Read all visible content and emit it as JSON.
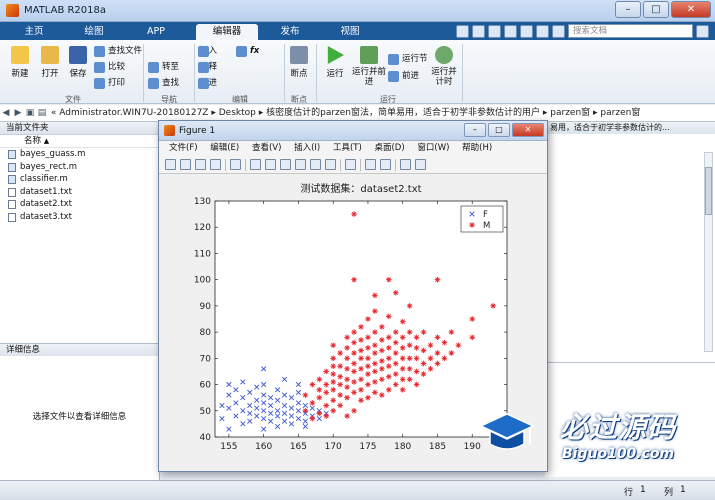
{
  "window": {
    "title": "MATLAB R2018a"
  },
  "tabs": [
    "主页",
    "绘图",
    "APP",
    "编辑器",
    "发布",
    "视图"
  ],
  "search": {
    "placeholder": "搜索文档"
  },
  "ribbon": {
    "file_group": {
      "new": "新建",
      "open": "打开",
      "save": "保存",
      "find_file": "查找文件",
      "compare": "比较",
      "print": "打印",
      "label": "文件"
    },
    "nav_group": {
      "goto": "转至",
      "find": "查找",
      "label": "导航"
    },
    "edit_group": {
      "insert": "插入",
      "comment": "注释",
      "indent": "缩进",
      "fx": "fx",
      "label": "编辑"
    },
    "breakpoint_group": {
      "breakpoints": "断点",
      "label": "断点"
    },
    "run_group": {
      "run": "运行",
      "run_advance": "运行并前进",
      "run_section": "运行节",
      "advance": "前进",
      "run_time": "运行并计时",
      "label": "运行"
    }
  },
  "address": {
    "segments": [
      "«",
      "Administrator.WIN7U-20180127Z",
      "Desktop",
      "核密度估计的parzen窗法，简单易用，适合于初学非参数估计的用户",
      "parzen窗",
      "parzen窗"
    ]
  },
  "left_panel": {
    "title": "当前文件夹",
    "column": "名称",
    "sort": "▲",
    "files": [
      {
        "name": "bayes_guass.m",
        "type": "m"
      },
      {
        "name": "bayes_rect.m",
        "type": "m"
      },
      {
        "name": "classifier.m",
        "type": "m"
      },
      {
        "name": "dataset1.txt",
        "type": "txt"
      },
      {
        "name": "dataset2.txt",
        "type": "txt"
      },
      {
        "name": "dataset3.txt",
        "type": "txt"
      }
    ],
    "details_title": "详细信息",
    "details_msg": "选择文件以查看详细信息"
  },
  "right_panel": {
    "header_text": "易用，适合于初学非参数估计的..."
  },
  "status": {
    "row_label": "行",
    "row_value": "1",
    "col_label": "列",
    "col_value": "1"
  },
  "figure": {
    "title": "Figure 1",
    "menu": [
      "文件(F)",
      "编辑(E)",
      "查看(V)",
      "插入(I)",
      "工具(T)",
      "桌面(D)",
      "窗口(W)",
      "帮助(H)"
    ]
  },
  "watermark": {
    "line1": "必过源码",
    "line2": "Biguo100.com"
  },
  "chart_data": {
    "type": "scatter",
    "title": "测试数据集：dataset2.txt",
    "xlabel": "",
    "ylabel": "",
    "xlim": [
      153,
      195
    ],
    "ylim": [
      40,
      130
    ],
    "xticks": [
      155,
      160,
      165,
      170,
      175,
      180,
      185,
      190
    ],
    "yticks": [
      40,
      50,
      60,
      70,
      80,
      90,
      100,
      110,
      120,
      130
    ],
    "grid": false,
    "legend_position": "top-right",
    "series": [
      {
        "name": "F",
        "marker": "x",
        "color": "#3b55d8",
        "points": [
          [
            154,
            47
          ],
          [
            154,
            52
          ],
          [
            155,
            43
          ],
          [
            155,
            51
          ],
          [
            155,
            56
          ],
          [
            156,
            48
          ],
          [
            156,
            53
          ],
          [
            156,
            58
          ],
          [
            157,
            45
          ],
          [
            157,
            50
          ],
          [
            157,
            55
          ],
          [
            158,
            46
          ],
          [
            158,
            49
          ],
          [
            158,
            52
          ],
          [
            158,
            57
          ],
          [
            159,
            48
          ],
          [
            159,
            51
          ],
          [
            159,
            54
          ],
          [
            160,
            43
          ],
          [
            160,
            47
          ],
          [
            160,
            50
          ],
          [
            160,
            53
          ],
          [
            160,
            56
          ],
          [
            160,
            60
          ],
          [
            160,
            66
          ],
          [
            161,
            46
          ],
          [
            161,
            49
          ],
          [
            161,
            52
          ],
          [
            161,
            55
          ],
          [
            162,
            44
          ],
          [
            162,
            48
          ],
          [
            162,
            50
          ],
          [
            162,
            54
          ],
          [
            162,
            58
          ],
          [
            163,
            46
          ],
          [
            163,
            49
          ],
          [
            163,
            52
          ],
          [
            163,
            56
          ],
          [
            164,
            45
          ],
          [
            164,
            48
          ],
          [
            164,
            51
          ],
          [
            164,
            55
          ],
          [
            165,
            47
          ],
          [
            165,
            50
          ],
          [
            165,
            53
          ],
          [
            165,
            57
          ],
          [
            166,
            46
          ],
          [
            166,
            49
          ],
          [
            166,
            52
          ],
          [
            167,
            48
          ],
          [
            167,
            51
          ],
          [
            168,
            47
          ],
          [
            168,
            50
          ],
          [
            169,
            49
          ],
          [
            155,
            60
          ],
          [
            157,
            61
          ],
          [
            159,
            59
          ],
          [
            163,
            62
          ],
          [
            165,
            60
          ],
          [
            166,
            44
          ]
        ]
      },
      {
        "name": "M",
        "marker": "*",
        "color": "#e8252b",
        "points": [
          [
            166,
            50
          ],
          [
            166,
            56
          ],
          [
            167,
            47
          ],
          [
            167,
            53
          ],
          [
            167,
            60
          ],
          [
            168,
            49
          ],
          [
            168,
            55
          ],
          [
            168,
            58
          ],
          [
            168,
            62
          ],
          [
            169,
            48
          ],
          [
            169,
            52
          ],
          [
            169,
            57
          ],
          [
            169,
            60
          ],
          [
            169,
            65
          ],
          [
            170,
            50
          ],
          [
            170,
            54
          ],
          [
            170,
            58
          ],
          [
            170,
            61
          ],
          [
            170,
            64
          ],
          [
            170,
            67
          ],
          [
            170,
            70
          ],
          [
            170,
            75
          ],
          [
            171,
            52
          ],
          [
            171,
            56
          ],
          [
            171,
            60
          ],
          [
            171,
            63
          ],
          [
            171,
            67
          ],
          [
            171,
            72
          ],
          [
            172,
            48
          ],
          [
            172,
            55
          ],
          [
            172,
            59
          ],
          [
            172,
            62
          ],
          [
            172,
            66
          ],
          [
            172,
            70
          ],
          [
            172,
            74
          ],
          [
            172,
            78
          ],
          [
            173,
            50
          ],
          [
            173,
            57
          ],
          [
            173,
            61
          ],
          [
            173,
            65
          ],
          [
            173,
            68
          ],
          [
            173,
            72
          ],
          [
            173,
            76
          ],
          [
            173,
            80
          ],
          [
            173,
            100
          ],
          [
            173,
            125
          ],
          [
            174,
            54
          ],
          [
            174,
            58
          ],
          [
            174,
            62
          ],
          [
            174,
            66
          ],
          [
            174,
            70
          ],
          [
            174,
            73
          ],
          [
            174,
            77
          ],
          [
            174,
            82
          ],
          [
            175,
            55
          ],
          [
            175,
            60
          ],
          [
            175,
            64
          ],
          [
            175,
            67
          ],
          [
            175,
            70
          ],
          [
            175,
            74
          ],
          [
            175,
            78
          ],
          [
            175,
            85
          ],
          [
            176,
            57
          ],
          [
            176,
            61
          ],
          [
            176,
            65
          ],
          [
            176,
            68
          ],
          [
            176,
            72
          ],
          [
            176,
            75
          ],
          [
            176,
            80
          ],
          [
            176,
            88
          ],
          [
            177,
            56
          ],
          [
            177,
            62
          ],
          [
            177,
            66
          ],
          [
            177,
            69
          ],
          [
            177,
            73
          ],
          [
            177,
            77
          ],
          [
            177,
            82
          ],
          [
            178,
            58
          ],
          [
            178,
            63
          ],
          [
            178,
            67
          ],
          [
            178,
            70
          ],
          [
            178,
            74
          ],
          [
            178,
            78
          ],
          [
            178,
            86
          ],
          [
            178,
            100
          ],
          [
            179,
            60
          ],
          [
            179,
            64
          ],
          [
            179,
            68
          ],
          [
            179,
            72
          ],
          [
            179,
            76
          ],
          [
            179,
            80
          ],
          [
            180,
            58
          ],
          [
            180,
            62
          ],
          [
            180,
            66
          ],
          [
            180,
            70
          ],
          [
            180,
            74
          ],
          [
            180,
            78
          ],
          [
            180,
            84
          ],
          [
            181,
            62
          ],
          [
            181,
            66
          ],
          [
            181,
            70
          ],
          [
            181,
            75
          ],
          [
            181,
            80
          ],
          [
            182,
            60
          ],
          [
            182,
            65
          ],
          [
            182,
            70
          ],
          [
            182,
            74
          ],
          [
            182,
            78
          ],
          [
            183,
            64
          ],
          [
            183,
            68
          ],
          [
            183,
            73
          ],
          [
            183,
            80
          ],
          [
            184,
            66
          ],
          [
            184,
            70
          ],
          [
            184,
            75
          ],
          [
            185,
            68
          ],
          [
            185,
            72
          ],
          [
            185,
            78
          ],
          [
            185,
            100
          ],
          [
            186,
            70
          ],
          [
            186,
            76
          ],
          [
            187,
            72
          ],
          [
            187,
            80
          ],
          [
            188,
            75
          ],
          [
            190,
            85
          ],
          [
            190,
            78
          ],
          [
            193,
            90
          ],
          [
            176,
            94
          ],
          [
            179,
            95
          ],
          [
            181,
            90
          ]
        ]
      }
    ]
  }
}
